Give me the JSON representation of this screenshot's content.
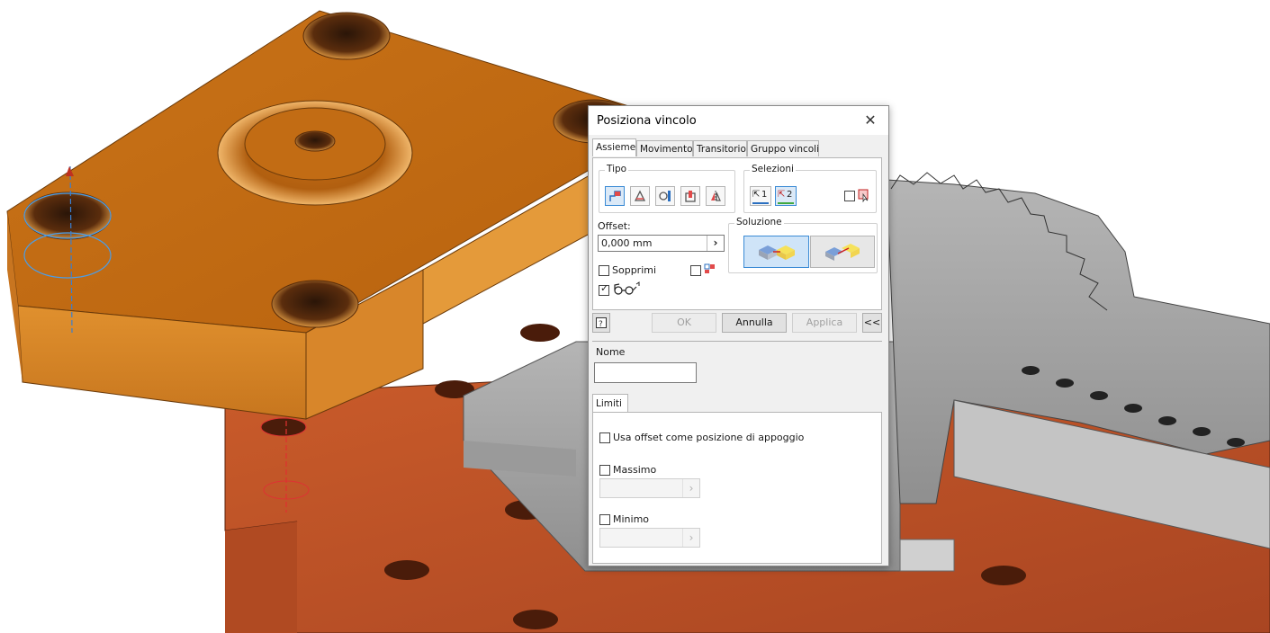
{
  "dialog": {
    "title": "Posiziona vincolo",
    "close_icon": "close-icon",
    "tabs": [
      {
        "label": "Assieme",
        "active": true
      },
      {
        "label": "Movimento",
        "active": false
      },
      {
        "label": "Transitorio",
        "active": false
      },
      {
        "label": "Gruppo vincoli",
        "active": false
      }
    ],
    "tipo": {
      "label": "Tipo",
      "buttons": [
        "mate-icon",
        "angle-icon",
        "tangent-icon",
        "insert-icon",
        "symmetry-icon"
      ]
    },
    "selezioni": {
      "label": "Selezioni",
      "sel1": "1",
      "sel2": "2",
      "pick_part_first_checked": false
    },
    "offset": {
      "label": "Offset:",
      "value": "0,000 mm"
    },
    "soluzione": {
      "label": "Soluzione",
      "options": [
        "mate-solution-icon",
        "flush-solution-icon"
      ],
      "selected": 0
    },
    "sopprimi": {
      "label": "Sopprimi",
      "checked": false
    },
    "predict_offset_checked": false,
    "show_preview_checked": true,
    "buttons": {
      "ok": "OK",
      "annulla": "Annulla",
      "applica": "Applica",
      "collapse": "<<"
    },
    "nome": {
      "label": "Nome",
      "value": ""
    },
    "limiti_tab": "Limiti",
    "limiti": {
      "usa_offset": {
        "label": "Usa offset come posizione di appoggio",
        "checked": false
      },
      "massimo": {
        "label": "Massimo",
        "checked": false
      },
      "minimo": {
        "label": "Minimo",
        "checked": false
      }
    }
  },
  "colors": {
    "orange_part": "#d77b1c",
    "red_part": "#c45a2b",
    "gray_part": "#a8a8a8",
    "accent": "#3b8bd5"
  }
}
